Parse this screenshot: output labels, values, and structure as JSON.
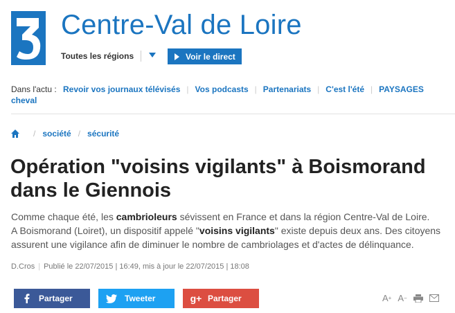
{
  "header": {
    "logo_text": "3",
    "site_title": "Centre-Val de Loire",
    "regions_label": "Toutes les régions",
    "live_button": "Voir le direct"
  },
  "actu": {
    "lead": "Dans l'actu :",
    "links": [
      "Revoir vos journaux télévisés",
      "Vos podcasts",
      "Partenariats",
      "C'est l'été",
      "PAYSAGES",
      "cheval"
    ]
  },
  "breadcrumb": {
    "items": [
      "société",
      "sécurité"
    ]
  },
  "article": {
    "title": "Opération \"voisins vigilants\" à Boismorand dans le Giennois",
    "chapo": {
      "p1_before": "Comme chaque été, les ",
      "p1_bold": "cambrioleurs",
      "p1_after": " sévissent en France et dans la région Centre-Val de Loire.",
      "p2_before": "A Boismorand (Loiret), un dispositif appelé \"",
      "p2_bold": "voisins vigilants",
      "p2_after": "\" existe depuis deux ans. Des citoyens assurent une vigilance afin de diminuer le nombre de cambriolages et d'actes de délinquance."
    },
    "author": "D.Cros",
    "published": "Publié le 22/07/2015 | 16:49, mis à jour le 22/07/2015 | 18:08"
  },
  "share": {
    "facebook": "Partager",
    "twitter": "Tweeter",
    "googleplus": "Partager",
    "gplus_glyph": "g+"
  },
  "tools": {
    "increase": "A",
    "decrease": "A",
    "plus": "+",
    "minus": "−"
  },
  "colors": {
    "brand": "#1b75c0",
    "facebook": "#3b5998",
    "twitter": "#1da1f2",
    "googleplus": "#dc4e41"
  }
}
